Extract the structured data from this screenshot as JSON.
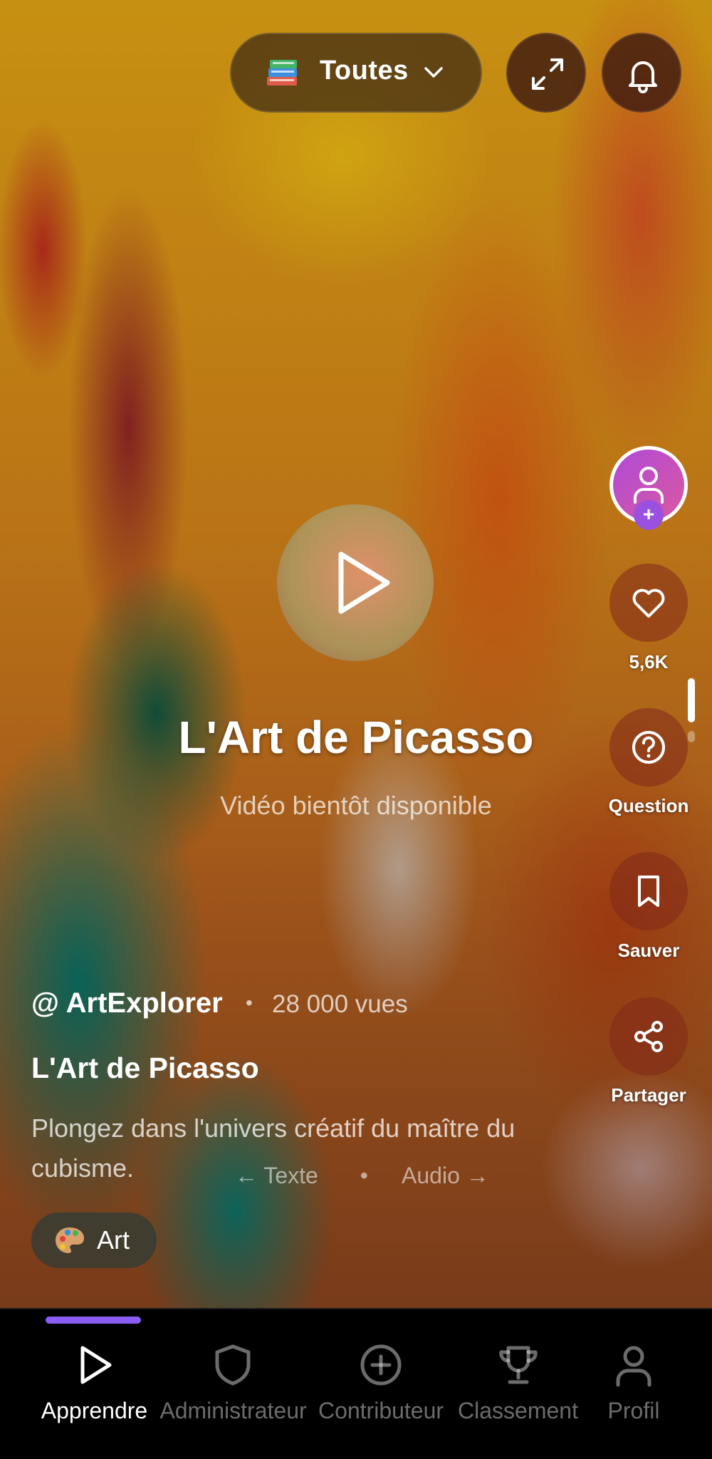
{
  "header": {
    "category": {
      "label": "Toutes",
      "icon": "books-icon"
    },
    "expand_icon": "expand-icon",
    "notifications_icon": "bell-icon"
  },
  "video": {
    "center_title": "L'Art de Picasso",
    "status": "Vidéo bientôt disponible",
    "author": "@ ArtExplorer",
    "bullet": "•",
    "views": "28 000 vues",
    "title": "L'Art de Picasso",
    "description": "Plongez dans l'univers créatif du maître du cubisme.",
    "tag": {
      "label": "Art",
      "icon": "palette-icon"
    }
  },
  "mode_switch": {
    "left": "← Texte",
    "separator": "•",
    "right": "Audio →"
  },
  "rail": {
    "follow_symbol": "+",
    "like_count": "5,6K",
    "question": "Question",
    "save": "Sauver",
    "share": "Partager"
  },
  "nav": {
    "items": [
      {
        "label": "Apprendre",
        "icon": "play-icon",
        "active": true
      },
      {
        "label": "Administrateur",
        "icon": "shield-icon",
        "active": false
      },
      {
        "label": "Contributeur",
        "icon": "plus-circle-icon",
        "active": false
      },
      {
        "label": "Classement",
        "icon": "trophy-icon",
        "active": false
      },
      {
        "label": "Profil",
        "icon": "user-icon",
        "active": false
      }
    ]
  },
  "colors": {
    "accent": "#8b5cf6",
    "avatar_gradient_start": "#b04ad8",
    "avatar_gradient_end": "#d958a0"
  }
}
